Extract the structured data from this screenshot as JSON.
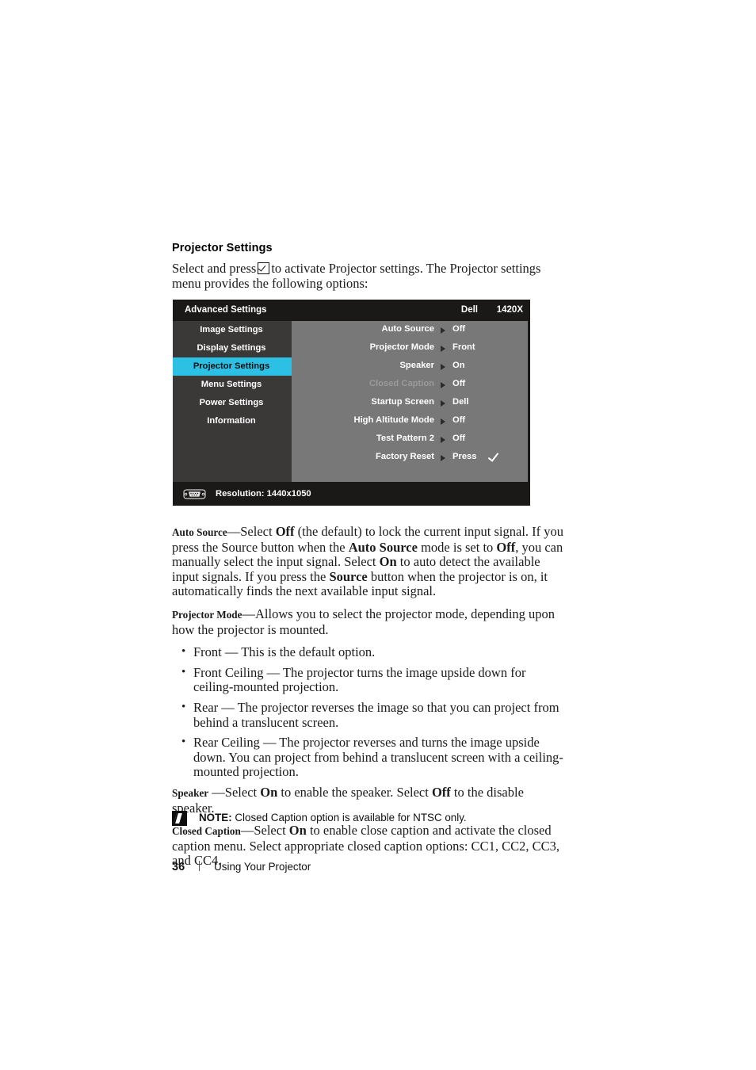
{
  "section": {
    "heading": "Projector Settings",
    "intro_part1": "Select and press",
    "intro_part2": "to activate Projector settings. The Projector settings menu provides the following options:",
    "check_icon": "checkbox-check-icon"
  },
  "osd": {
    "header": {
      "title": "Advanced Settings",
      "brand": "Dell",
      "model": "1420X"
    },
    "sidebar": {
      "items": [
        {
          "label": "Image Settings",
          "active": false
        },
        {
          "label": "Display Settings",
          "active": false
        },
        {
          "label": "Projector Settings",
          "active": true
        },
        {
          "label": "Menu Settings",
          "active": false
        },
        {
          "label": "Power Settings",
          "active": false
        },
        {
          "label": "Information",
          "active": false
        }
      ]
    },
    "rows": [
      {
        "label": "Auto Source",
        "value": "Off",
        "dim": false,
        "tick": false
      },
      {
        "label": "Projector Mode",
        "value": "Front",
        "dim": false,
        "tick": false
      },
      {
        "label": "Speaker",
        "value": "On",
        "dim": false,
        "tick": false
      },
      {
        "label": "Closed Caption",
        "value": "Off",
        "dim": true,
        "tick": false
      },
      {
        "label": "Startup Screen",
        "value": "Dell",
        "dim": false,
        "tick": false
      },
      {
        "label": "High Altitude Mode",
        "value": "Off",
        "dim": false,
        "tick": false
      },
      {
        "label": "Test Pattern 2",
        "value": "Off",
        "dim": false,
        "tick": false
      },
      {
        "label": "Factory Reset",
        "value": "Press",
        "dim": false,
        "tick": true
      }
    ],
    "footer": {
      "resolution": "Resolution: 1440x1050",
      "icon": "vga-connector-icon"
    },
    "colors": {
      "header_bg": "#1b1818",
      "sidebar_bg": "#3b3838",
      "panel_bg": "#787878",
      "highlight": "#2cc0e4",
      "text": "#ffffff",
      "dim_text": "#9a9a9a"
    }
  },
  "defs": {
    "auto_source": {
      "term": "Auto Source",
      "body_1": "—Select ",
      "bold_1": "Off",
      "body_2": " (the default) to lock the current input signal. If you press the Source button when the ",
      "bold_2": "Auto Source",
      "body_3": " mode is set to ",
      "bold_3": "Off",
      "body_4": ", you can manually select the input signal. Select ",
      "bold_4": "On",
      "body_5": " to auto detect the available input signals. If you press the ",
      "bold_5": "Source",
      "body_6": " button when the projector is on, it automatically finds the next available input signal."
    },
    "projector_mode": {
      "term": "Projector Mode",
      "body": "—Allows you to select the projector mode, depending upon how the projector is mounted.",
      "bullets": [
        "Front — This is the default option.",
        "Front Ceiling — The projector turns the image upside down for ceiling-mounted projection.",
        "Rear — The projector reverses the image so that you can project from behind a translucent screen.",
        "Rear Ceiling — The projector reverses and turns the image upside down. You can project from behind a translucent screen with a ceiling-mounted projection."
      ]
    },
    "speaker": {
      "term": "Speaker",
      "body_1": " —Select ",
      "bold_1": "On",
      "body_2": " to enable the speaker. Select ",
      "bold_2": "Off",
      "body_3": " to the disable speaker."
    },
    "closed_caption": {
      "term": "Closed Caption",
      "body_1": "—Select ",
      "bold_1": "On",
      "body_2": " to enable close caption and activate the closed caption menu. Select appropriate closed caption options: CC1, CC2, CC3, and CC4."
    }
  },
  "note": {
    "icon": "note-pencil-icon",
    "label": "NOTE:",
    "text": " Closed Caption option is available for NTSC only."
  },
  "page_footer": {
    "page_number": "36",
    "title": "Using Your Projector"
  }
}
